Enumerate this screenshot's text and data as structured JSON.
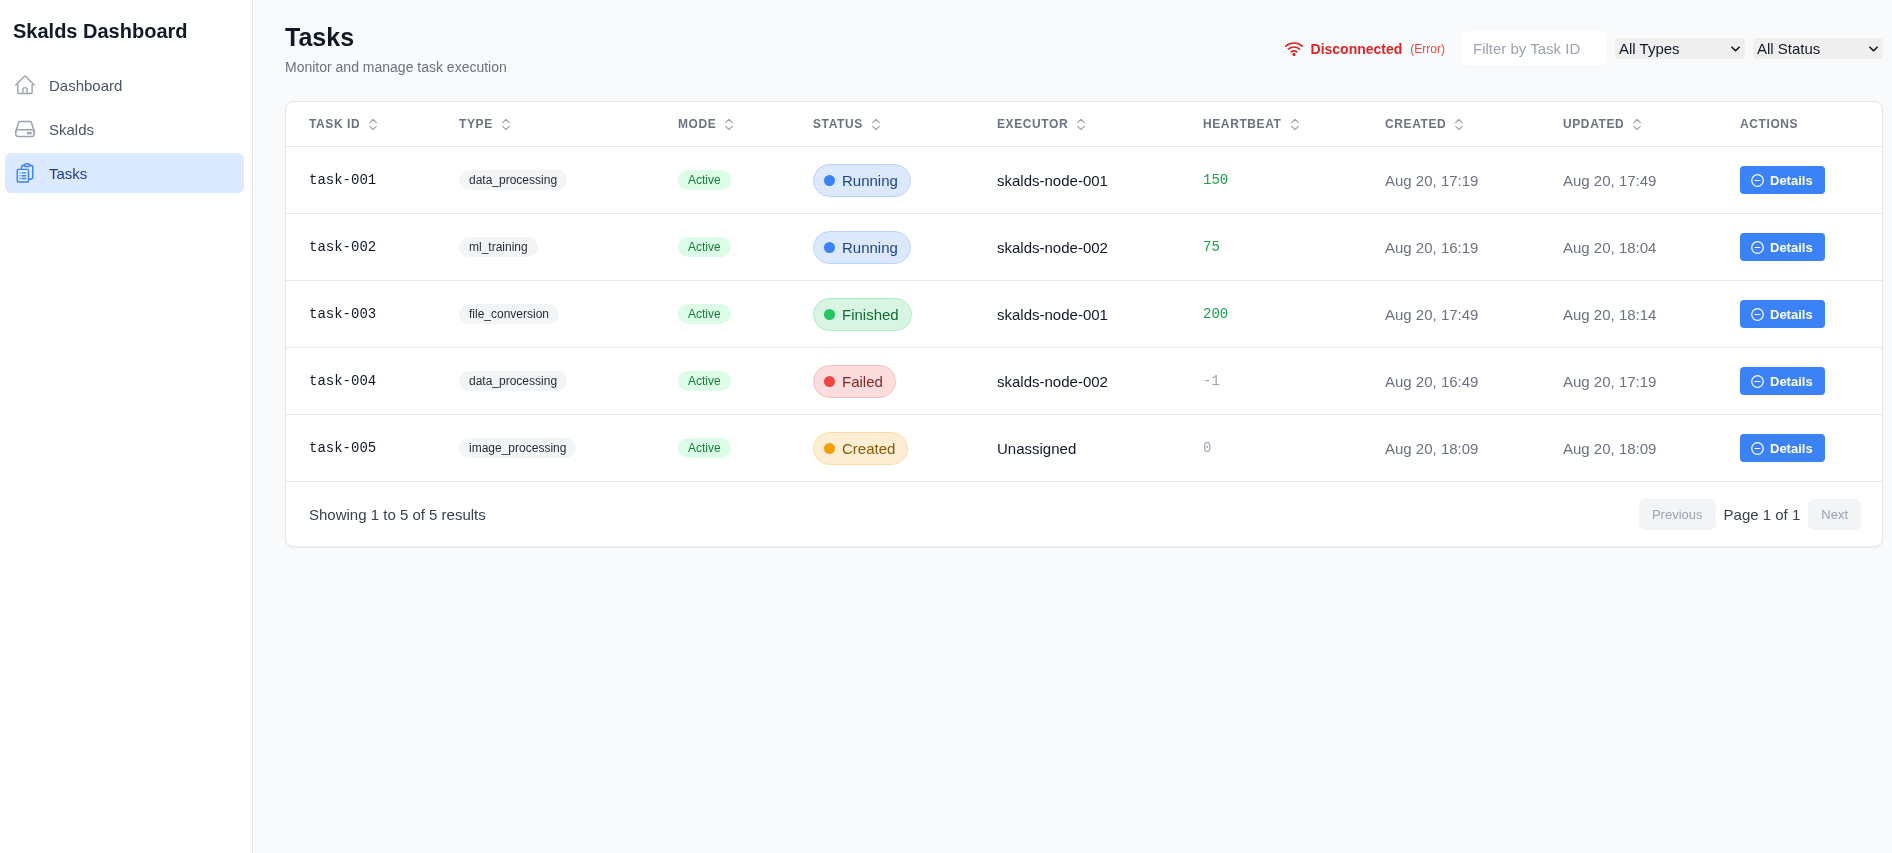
{
  "sidebar": {
    "title": "Skalds Dashboard",
    "items": [
      {
        "label": "Dashboard",
        "selected": false
      },
      {
        "label": "Skalds",
        "selected": false
      },
      {
        "label": "Tasks",
        "selected": true
      }
    ]
  },
  "header": {
    "title": "Tasks",
    "subtitle": "Monitor and manage task execution",
    "connection": {
      "label": "Disconnected",
      "detail": "(Error)",
      "connected": false
    },
    "search": {
      "placeholder": "Filter by Task ID"
    },
    "type_filter": {
      "value": "All Types"
    },
    "status_filter": {
      "value": "All Status"
    }
  },
  "table": {
    "columns": [
      {
        "label": "TASK ID",
        "sortable": true
      },
      {
        "label": "TYPE",
        "sortable": true
      },
      {
        "label": "MODE",
        "sortable": true
      },
      {
        "label": "STATUS",
        "sortable": true
      },
      {
        "label": "EXECUTOR",
        "sortable": true
      },
      {
        "label": "HEARTBEAT",
        "sortable": true
      },
      {
        "label": "CREATED",
        "sortable": true
      },
      {
        "label": "UPDATED",
        "sortable": true
      },
      {
        "label": "ACTIONS",
        "sortable": false
      }
    ],
    "rows": [
      {
        "task_id": "task-001",
        "type": "data_processing",
        "mode": "Active",
        "status": {
          "label": "Running",
          "color": "#3b82f6"
        },
        "executor": "skalds-node-001",
        "heartbeat": {
          "value": "150",
          "color": "#16a34a"
        },
        "created": "Aug 20, 17:19",
        "updated": "Aug 20, 17:49",
        "action": "Details"
      },
      {
        "task_id": "task-002",
        "type": "ml_training",
        "mode": "Active",
        "status": {
          "label": "Running",
          "color": "#3b82f6"
        },
        "executor": "skalds-node-002",
        "heartbeat": {
          "value": "75",
          "color": "#16a34a"
        },
        "created": "Aug 20, 16:19",
        "updated": "Aug 20, 18:04",
        "action": "Details"
      },
      {
        "task_id": "task-003",
        "type": "file_conversion",
        "mode": "Active",
        "status": {
          "label": "Finished",
          "color": "#22c55e"
        },
        "executor": "skalds-node-001",
        "heartbeat": {
          "value": "200",
          "color": "#16a34a"
        },
        "created": "Aug 20, 17:49",
        "updated": "Aug 20, 18:14",
        "action": "Details"
      },
      {
        "task_id": "task-004",
        "type": "data_processing",
        "mode": "Active",
        "status": {
          "label": "Failed",
          "color": "#ef4444"
        },
        "executor": "skalds-node-002",
        "heartbeat": {
          "value": "-1",
          "color": "#9ca3af"
        },
        "created": "Aug 20, 16:49",
        "updated": "Aug 20, 17:19",
        "action": "Details"
      },
      {
        "task_id": "task-005",
        "type": "image_processing",
        "mode": "Active",
        "status": {
          "label": "Created",
          "color": "#f59e0b"
        },
        "executor": "Unassigned",
        "heartbeat": {
          "value": "0",
          "color": "#9ca3af"
        },
        "created": "Aug 20, 18:09",
        "updated": "Aug 20, 18:09",
        "action": "Details"
      }
    ],
    "footer": {
      "summary": "Showing 1 to 5 of 5 results",
      "previous": {
        "label": "Previous",
        "disabled": true
      },
      "page": "Page 1 of 1",
      "next": {
        "label": "Next",
        "disabled": true
      }
    }
  }
}
